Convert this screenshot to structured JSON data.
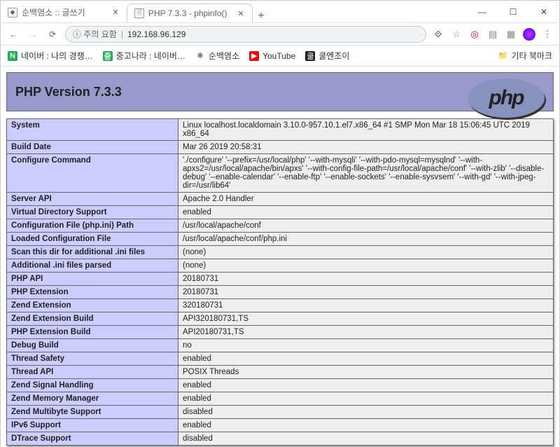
{
  "window": {
    "tabs": [
      {
        "title": "순백염소 :: 글쓰기",
        "active": false
      },
      {
        "title": "PHP 7.3.3 - phpinfo()",
        "active": true
      }
    ],
    "minimize": "—",
    "maximize": "☐",
    "close": "✕"
  },
  "addressbar": {
    "security_chip": "ⓘ 주의 요함",
    "url": "192.168.96.129"
  },
  "bookmarks": {
    "items": [
      {
        "ico_class": "ico-green",
        "glyph": "N",
        "label": "네이버 : 나의 경쟁…"
      },
      {
        "ico_class": "ico-green",
        "glyph": "중",
        "label": "중고나라 : 네이버…"
      },
      {
        "ico_class": "",
        "glyph": "❄",
        "label": "순백염소"
      },
      {
        "ico_class": "ico-red",
        "glyph": "▶",
        "label": "YouTube"
      },
      {
        "ico_class": "ico-blk",
        "glyph": "쿨",
        "label": "쿨엔조이"
      }
    ],
    "other": "기타 북마크"
  },
  "php": {
    "header_title": "PHP Version 7.3.3",
    "logo_text": "php",
    "rows": [
      {
        "k": "System",
        "v": "Linux localhost.localdomain 3.10.0-957.10.1.el7.x86_64 #1 SMP Mon Mar 18 15:06:45 UTC 2019 x86_64"
      },
      {
        "k": "Build Date",
        "v": "Mar 26 2019 20:58:31"
      },
      {
        "k": "Configure Command",
        "v": "'./configure' '--prefix=/usr/local/php' '--with-mysqli' '--with-pdo-mysql=mysqlnd' '--with-apxs2=/usr/local/apache/bin/apxs' '--with-config-file-path=/usr/local/apache/conf' '--with-zlib' '--disable-debug' '--enable-calendar' '--enable-ftp' '--enable-sockets' '--enable-sysvsem' '--with-gd' '--with-jpeg-dir=/usr/lib64'"
      },
      {
        "k": "Server API",
        "v": "Apache 2.0 Handler"
      },
      {
        "k": "Virtual Directory Support",
        "v": "enabled"
      },
      {
        "k": "Configuration File (php.ini) Path",
        "v": "/usr/local/apache/conf"
      },
      {
        "k": "Loaded Configuration File",
        "v": "/usr/local/apache/conf/php.ini"
      },
      {
        "k": "Scan this dir for additional .ini files",
        "v": "(none)"
      },
      {
        "k": "Additional .ini files parsed",
        "v": "(none)"
      },
      {
        "k": "PHP API",
        "v": "20180731"
      },
      {
        "k": "PHP Extension",
        "v": "20180731"
      },
      {
        "k": "Zend Extension",
        "v": "320180731"
      },
      {
        "k": "Zend Extension Build",
        "v": "API320180731,TS"
      },
      {
        "k": "PHP Extension Build",
        "v": "API20180731,TS"
      },
      {
        "k": "Debug Build",
        "v": "no"
      },
      {
        "k": "Thread Safety",
        "v": "enabled"
      },
      {
        "k": "Thread API",
        "v": "POSIX Threads"
      },
      {
        "k": "Zend Signal Handling",
        "v": "enabled"
      },
      {
        "k": "Zend Memory Manager",
        "v": "enabled"
      },
      {
        "k": "Zend Multibyte Support",
        "v": "disabled"
      },
      {
        "k": "IPv6 Support",
        "v": "enabled"
      },
      {
        "k": "DTrace Support",
        "v": "disabled"
      }
    ]
  }
}
